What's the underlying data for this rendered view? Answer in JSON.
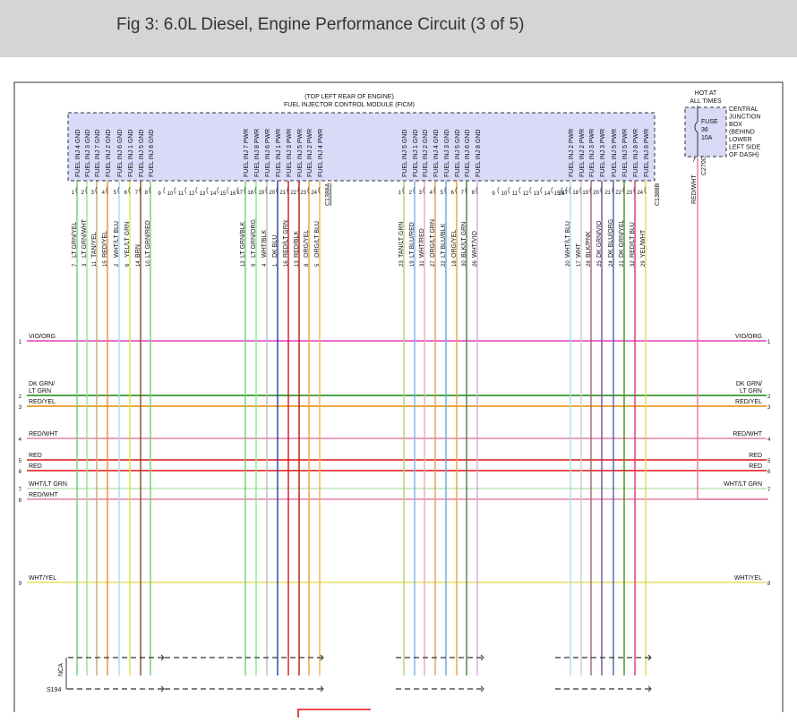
{
  "header": {
    "title": "Fig 3: 6.0L Diesel, Engine Performance Circuit (3 of 5)"
  },
  "ficm": {
    "location": "(TOP LEFT REAR OF ENGINE)",
    "name": "FUEL INJECTOR CONTROL MODULE (FICM)"
  },
  "fuse": {
    "hot_label_1": "HOT AT",
    "hot_label_2": "ALL TIMES",
    "label": "FUSE",
    "number": "36",
    "rating": "10A",
    "pin": "7",
    "connector": "C270C",
    "wire": "RED/WHT",
    "cjb": [
      "CENTRAL",
      "JUNCTION",
      "BOX",
      "(BEHIND",
      "LOWER",
      "LEFT SIDE",
      "OF DASH)"
    ]
  },
  "connectors": {
    "left": "C1388A",
    "right": "C1388B"
  },
  "splices": {
    "nca": "NCA",
    "s194": "S194"
  },
  "colors": {
    "vio_org": "#e040c0",
    "dk_grn": "#118811",
    "red_yel": "#e08a00",
    "red_wht": "#e87ea8",
    "red": "#dd1111",
    "wht_lt_grn": "#b8e6b8",
    "wht_yel": "#e6e060",
    "ficm_fill": "#d9d9f8",
    "fuse_fill": "#d9d9f8"
  },
  "left_wires": [
    {
      "ch": "FUEL INJ 4 GND",
      "pin": "1",
      "wc": "LT GRN/YEL",
      "cav": "7",
      "color": "#6ed36e"
    },
    {
      "ch": "FUEL INJ 3 GND",
      "pin": "2",
      "wc": "LT GRN/WHT",
      "cav": "3",
      "color": "#8ee68e"
    },
    {
      "ch": "FUEL INJ 7 GND",
      "pin": "3",
      "wc": "TAN/YEL",
      "cav": "11",
      "color": "#c9a96e"
    },
    {
      "ch": "FUEL INJ 2 GND",
      "pin": "4",
      "wc": "RED/YEL",
      "cav": "15",
      "color": "#ef8a2a"
    },
    {
      "ch": "FUEL INJ 6 GND",
      "pin": "5",
      "wc": "WHT/LT BLU",
      "cav": "2",
      "color": "#a8dcef"
    },
    {
      "ch": "FUEL INJ 1 GND",
      "pin": "6",
      "wc": "YEL/LT GRN",
      "cav": "6",
      "color": "#d6e04a"
    },
    {
      "ch": "FUEL INJ 5 GND",
      "pin": "7",
      "wc": "BRN",
      "cav": "14",
      "color": "#8a4d1a"
    },
    {
      "ch": "FUEL INJ 8 GND",
      "pin": "8",
      "wc": "LT GRN/RED",
      "cav": "10",
      "color": "#6ed36e"
    },
    {
      "ch": "FUEL INJ 7 PWR",
      "pin": "17",
      "wc": "LT GRN/BLK",
      "cav": "12",
      "color": "#6ed36e"
    },
    {
      "ch": "FUEL INJ 8 PWR",
      "pin": "18",
      "wc": "LT GRN/ORG",
      "cav": "9",
      "color": "#8ee68e"
    },
    {
      "ch": "FUEL INJ 6 PWR",
      "pin": "19",
      "wc": "WHT/BLK",
      "cav": "4",
      "color": "#bbbbbb"
    },
    {
      "ch": "FUEL INJ 1 PWR",
      "pin": "20",
      "wc": "DK BLU",
      "cav": "1",
      "color": "#2a3aa8"
    },
    {
      "ch": "FUEL INJ 3 PWR",
      "pin": "21",
      "wc": "RED/LT GRN",
      "cav": "16",
      "color": "#dd1111"
    },
    {
      "ch": "FUEL INJ 5 PWR",
      "pin": "22",
      "wc": "RED/BLK",
      "cav": "13",
      "color": "#b81414"
    },
    {
      "ch": "FUEL INJ 2 PWR",
      "pin": "23",
      "wc": "ORG/YEL",
      "cav": "8",
      "color": "#f0a040"
    },
    {
      "ch": "FUEL INJ 4 PWR",
      "pin": "24",
      "wc": "ORG/LT BLU",
      "cav": "5",
      "color": "#f5b050"
    }
  ],
  "left_unused_pins": [
    "9",
    "10",
    "11",
    "12",
    "13",
    "14",
    "15",
    "16"
  ],
  "right_wires": [
    {
      "ch": "FUEL INJ 5 GND",
      "pin": "1",
      "wc": "TAN/LT GRN",
      "cav": "23",
      "color": "#b3d16e"
    },
    {
      "ch": "FUEL INJ 1 GND",
      "pin": "2",
      "wc": "LT BLU/RED",
      "cav": "19",
      "color": "#7ab4ea"
    },
    {
      "ch": "FUEL INJ 2 GND",
      "pin": "3",
      "wc": "WHT/RED",
      "cav": "31",
      "color": "#efaaaa"
    },
    {
      "ch": "FUEL INJ 4 GND",
      "pin": "4",
      "wc": "ORG/LT GRN",
      "cav": "27",
      "color": "#e6a050"
    },
    {
      "ch": "FUEL INJ 3 GND",
      "pin": "5",
      "wc": "LT BLU/BLK",
      "cav": "22",
      "color": "#6aa8d8"
    },
    {
      "ch": "FUEL INJ 5 GND",
      "pin": "6",
      "wc": "ORG/YEL",
      "cav": "18",
      "color": "#f0a040"
    },
    {
      "ch": "FUEL INJ 6 GND",
      "pin": "7",
      "wc": "BLK/LT GRN",
      "cav": "30",
      "color": "#4e7e4e"
    },
    {
      "ch": "FUEL INJ 8 GND",
      "pin": "8",
      "wc": "WHT/VIO",
      "cav": "26",
      "color": "#d6a8e6"
    },
    {
      "ch": "FUEL INJ 2 PWR",
      "pin": "17",
      "wc": "WHT/LT BLU",
      "cav": "20",
      "color": "#a8dcef"
    },
    {
      "ch": "FUEL INJ 2 PWR",
      "pin": "18",
      "wc": "WHT",
      "cav": "17",
      "color": "#cccccc"
    },
    {
      "ch": "FUEL INJ 3 PWR",
      "pin": "19",
      "wc": "BLK/PNK",
      "cav": "28",
      "color": "#9a6a7a"
    },
    {
      "ch": "FUEL INJ 3 PWR",
      "pin": "20",
      "wc": "DK GRN/VIO",
      "cav": "25",
      "color": "#7a4aa0"
    },
    {
      "ch": "FUEL INJ 5 PWR",
      "pin": "21",
      "wc": "DK BLU/ORG",
      "cav": "24",
      "color": "#5a5aa8"
    },
    {
      "ch": "FUEL INJ 5 PWR",
      "pin": "22",
      "wc": "DK GRN/YEL",
      "cav": "21",
      "color": "#3f8f1f"
    },
    {
      "ch": "FUEL INJ 8 PWR",
      "pin": "23",
      "wc": "RED/LT BLU",
      "cav": "32",
      "color": "#d63a6a"
    },
    {
      "ch": "FUEL INJ 8 PWR",
      "pin": "24",
      "wc": "YEL/WHT",
      "cav": "29",
      "color": "#e6d84a"
    }
  ],
  "right_unused_pins": [
    "9",
    "10",
    "11",
    "12",
    "13",
    "14",
    "15",
    "16"
  ],
  "buses": [
    {
      "l1": "VIO/ORG",
      "l2": "",
      "ln": "1",
      "r1": "VIO/ORG",
      "r2": "",
      "rn": "1",
      "color": "#e040c0"
    },
    {
      "l1": "DK GRN/",
      "l2": "LT GRN",
      "ln": "2",
      "r1": "DK GRN/",
      "r2": "LT GRN",
      "rn": "2",
      "color": "#118811"
    },
    {
      "l1": "RED/YEL",
      "l2": "",
      "ln": "3",
      "r1": "RED/YEL",
      "r2": "",
      "rn": "3",
      "color": "#e08a00"
    },
    {
      "l1": "RED/WHT",
      "l2": "",
      "ln": "4",
      "r1": "RED/WHT",
      "r2": "",
      "rn": "4",
      "color": "#e87ea8"
    },
    {
      "l1": "RED",
      "l2": "",
      "ln": "5",
      "r1": "RED",
      "r2": "",
      "rn": "5",
      "color": "#dd1111"
    },
    {
      "l1": "RED",
      "l2": "",
      "ln": "6",
      "r1": "RED",
      "r2": "",
      "rn": "6",
      "color": "#dd1111"
    },
    {
      "l1": "WHT/LT GRN",
      "l2": "",
      "ln": "7",
      "r1": "WHT/LT GRN",
      "r2": "",
      "rn": "7",
      "color": "#b8e6b8"
    },
    {
      "l1": "RED/WHT",
      "l2": "",
      "ln": "8",
      "r1": "",
      "r2": "",
      "rn": "",
      "color": "#e87ea8"
    },
    {
      "l1": "WHT/YEL",
      "l2": "",
      "ln": "9",
      "r1": "WHT/YEL",
      "r2": "",
      "rn": "8",
      "color": "#e6e060"
    }
  ]
}
